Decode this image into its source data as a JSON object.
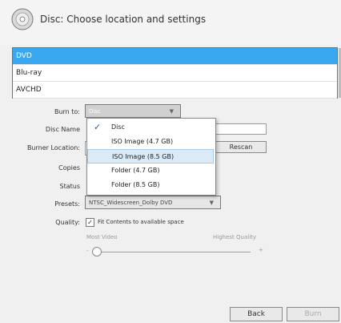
{
  "header": {
    "title": "Disc: Choose location and settings"
  },
  "disc_types": [
    "DVD",
    "Blu-ray",
    "AVCHD"
  ],
  "form": {
    "burn_to_label": "Burn to:",
    "burn_to_value": "Disc",
    "disc_name_label": "Disc Name",
    "burner_location_label": "Burner Location:",
    "rescan_label": "Rescan",
    "copies_label": "Copies",
    "status_label": "Status",
    "presets_label": "Presets:",
    "presets_value": "NTSC_Widescreen_Dolby DVD",
    "quality_label": "Quality:",
    "fit_contents_label": "Fit Contents to available space",
    "most_video_label": "Most Video",
    "highest_quality_label": "Highest Quality",
    "slider_minus": "-",
    "slider_plus": "+"
  },
  "dropdown": {
    "items": [
      {
        "label": "Disc",
        "checked": true
      },
      {
        "label": "ISO Image (4.7 GB)"
      },
      {
        "label": "ISO Image (8.5 GB)",
        "hover": true
      },
      {
        "label": "Folder (4.7 GB)"
      },
      {
        "label": "Folder (8.5 GB)"
      }
    ]
  },
  "footer": {
    "back_label": "Back",
    "burn_label": "Burn"
  },
  "colors": {
    "selected_bg": "#3aa8f0",
    "accent": "#1a5fb4"
  }
}
